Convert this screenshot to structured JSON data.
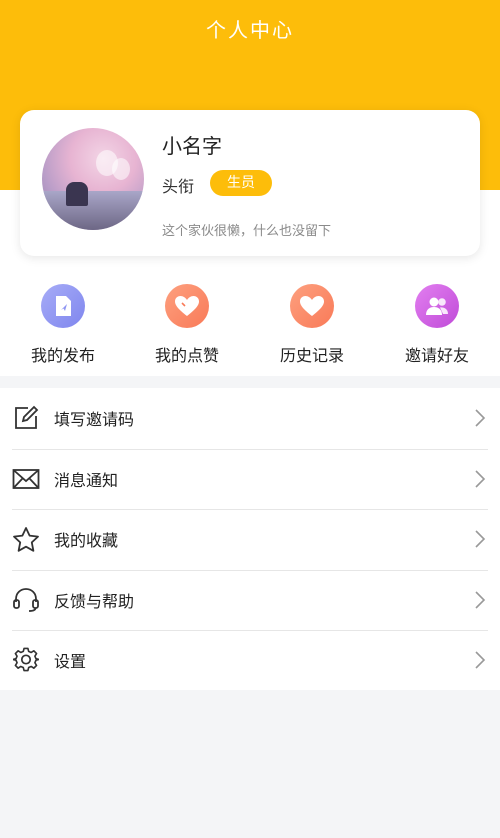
{
  "header": {
    "title": "个人中心",
    "bg_color": "#fdbd0a"
  },
  "profile": {
    "name": "小名字",
    "title_label": "头衔",
    "badge": "生员",
    "bio": "这个家伙很懒，什么也没留下",
    "avatar_icon": "avatar-photo"
  },
  "quick_actions": [
    {
      "label": "我的发布",
      "icon": "publish-icon",
      "color": "#8f96f2"
    },
    {
      "label": "我的点赞",
      "icon": "like-icon",
      "color": "#fb8c69"
    },
    {
      "label": "历史记录",
      "icon": "history-icon",
      "color": "#fb8c69"
    },
    {
      "label": "邀请好友",
      "icon": "invite-friends-icon",
      "color": "#d05de0"
    }
  ],
  "menu": [
    {
      "label": "填写邀请码",
      "icon": "edit-icon"
    },
    {
      "label": "消息通知",
      "icon": "mail-icon"
    },
    {
      "label": "我的收藏",
      "icon": "star-icon"
    },
    {
      "label": "反馈与帮助",
      "icon": "headset-icon"
    },
    {
      "label": "设置",
      "icon": "gear-icon"
    }
  ]
}
